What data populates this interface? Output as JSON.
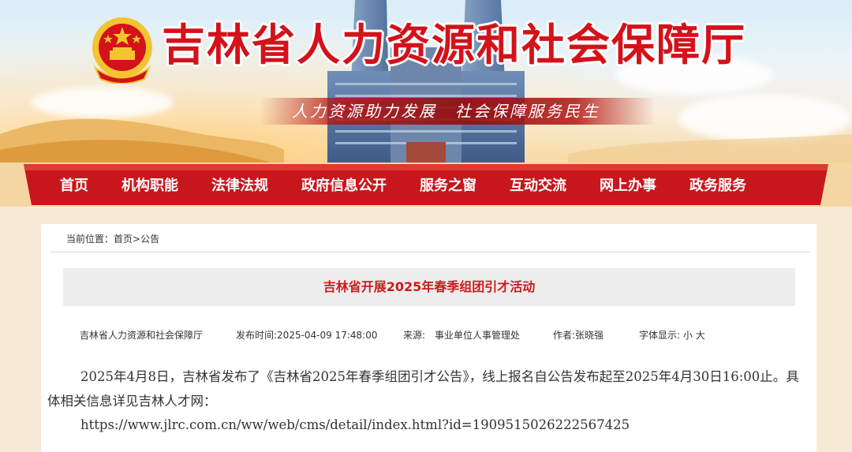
{
  "header": {
    "site_title": "吉林省人力资源和社会保障厅",
    "slogan": "人力资源助力发展　社会保障服务民生"
  },
  "nav": {
    "items": [
      {
        "label": "首页"
      },
      {
        "label": "机构职能"
      },
      {
        "label": "法律法规"
      },
      {
        "label": "政府信息公开"
      },
      {
        "label": "服务之窗"
      },
      {
        "label": "互动交流"
      },
      {
        "label": "网上办事"
      },
      {
        "label": "政务服务"
      }
    ]
  },
  "breadcrumb": {
    "prefix": "当前位置：",
    "home": "首页",
    "separator": ">",
    "current": "公告"
  },
  "article": {
    "title": "吉林省开展2025年春季组团引才活动",
    "meta": {
      "source": "吉林省人力资源和社会保障厅",
      "publish_time": "发布时间:2025-04-09 17:48:00",
      "origin": "来源:　事业单位人事管理处",
      "author": "作者:张晓强",
      "font_size_label": "字体显示:",
      "font_small": "小",
      "font_large": "大"
    },
    "paragraph": "2025年4月8日，吉林省发布了《吉林省2025年春季组团引才公告》，线上报名自公告发布起至2025年4月30日16:00止。具体相关信息详见吉林人才网：",
    "url": "https://www.jlrc.com.cn/ww/web/cms/detail/index.html?id=1909515026222567425"
  },
  "colors": {
    "brand_red": "#d3121a",
    "nav_red": "#c8161d",
    "title_red": "#c81d1d"
  }
}
